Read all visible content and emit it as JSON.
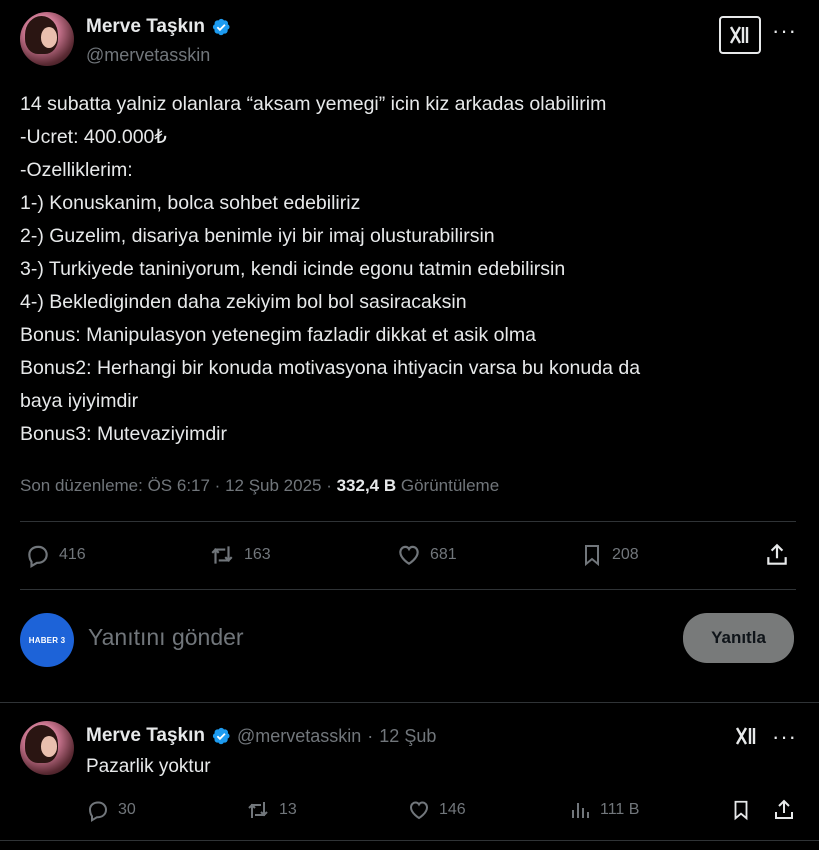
{
  "tweet": {
    "author_name": "Merve Taşkın",
    "author_handle": "@mervetasskin",
    "text_lines": [
      "14 subatta yalniz olanlara “aksam yemegi” icin kiz arkadas olabilirim",
      "-Ucret: 400.000₺",
      "-Ozelliklerim:",
      "1-) Konuskanim, bolca sohbet edebiliriz",
      "2-) Guzelim, disariya benimle iyi bir imaj olusturabilirsin",
      "3-) Turkiyede taniniyorum, kendi icinde egonu tatmin edebilirsin",
      "4-) Beklediginden daha zekiyim bol bol sasiracaksin",
      "Bonus: Manipulasyon yetenegim fazladir dikkat et asik olma",
      "Bonus2: Herhangi bir konuda motivasyona ihtiyacin varsa bu konuda da",
      "baya iyiyimdir",
      "Bonus3: Mutevaziyimdir"
    ],
    "meta_prefix": "Son düzenleme: ÖS 6:17 · 12 Şub 2025 · ",
    "views_count": "332,4 B",
    "views_label": "Görüntüleme",
    "stats": {
      "replies": "416",
      "retweets": "163",
      "likes": "681",
      "bookmarks": "208"
    }
  },
  "compose": {
    "avatar_label": "HABER 3",
    "placeholder": "Yanıtını gönder",
    "button_label": "Yanıtla"
  },
  "reply": {
    "author_name": "Merve Taşkın",
    "author_handle": "@mervetasskin",
    "separator": "·",
    "date": "12 Şub",
    "text": "Pazarlik yoktur",
    "stats": {
      "replies": "30",
      "retweets": "13",
      "likes": "146",
      "views": "111 B"
    }
  },
  "icons": {
    "x_logo": "x-logo-icon",
    "more": "more-icon",
    "verified": "verified-badge-icon"
  },
  "colors": {
    "background": "#000000",
    "text": "#e7e9ea",
    "muted": "#71767b",
    "verified": "#1d9bf0",
    "divider": "#2f3336",
    "reply_button": "#787a7a",
    "haber_badge": "#1d63d8"
  }
}
